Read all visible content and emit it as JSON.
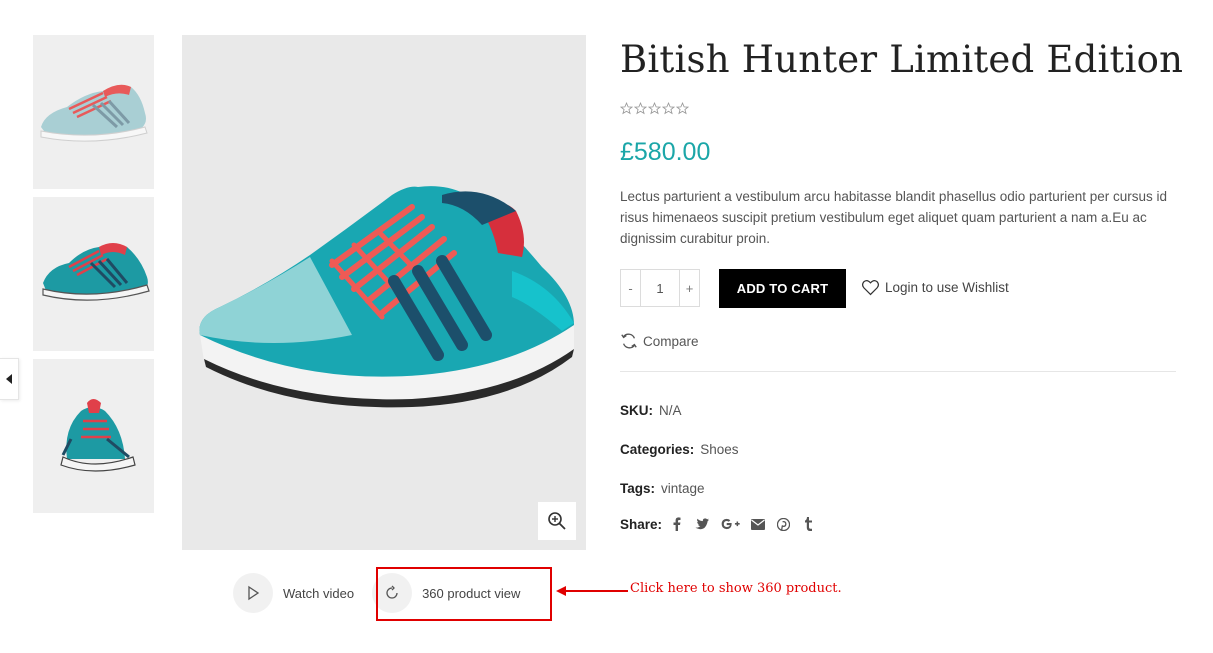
{
  "product": {
    "title": "Bitish Hunter Limited Edition",
    "rating_stars": 5,
    "rating_filled": 0,
    "price": "£580.00",
    "description": "Lectus parturient a vestibulum arcu habitasse blandit phasellus odio parturient per cursus id risus himenaeos suscipit pretium vestibulum eget aliquet quam parturient a nam a.Eu ac dignissim curabitur proin."
  },
  "cart": {
    "minus_label": "-",
    "qty_value": "1",
    "plus_label": "+",
    "add_to_cart_label": "ADD TO CART",
    "wishlist_label": "Login to use Wishlist",
    "compare_label": "Compare"
  },
  "meta": {
    "sku_label": "SKU:",
    "sku_value": "N/A",
    "categories_label": "Categories:",
    "categories_value": "Shoes",
    "tags_label": "Tags:",
    "tags_value": "vintage",
    "share_label": "Share:",
    "share_icons": [
      "facebook-icon",
      "twitter-icon",
      "google-plus-icon",
      "email-icon",
      "pinterest-icon",
      "tumblr-icon"
    ]
  },
  "gallery": {
    "thumbnails": [
      "shoe-side-light",
      "shoe-side-dark",
      "shoe-front"
    ],
    "media_buttons": {
      "watch_video": "Watch video",
      "product_360": "360 product view"
    }
  },
  "annotation": {
    "text": "Click here to show 360 product."
  },
  "colors": {
    "accent_price": "#1ba6a8",
    "annotation_red": "#e00000",
    "cart_button_bg": "#000000",
    "image_bg": "#e9e9e9"
  }
}
